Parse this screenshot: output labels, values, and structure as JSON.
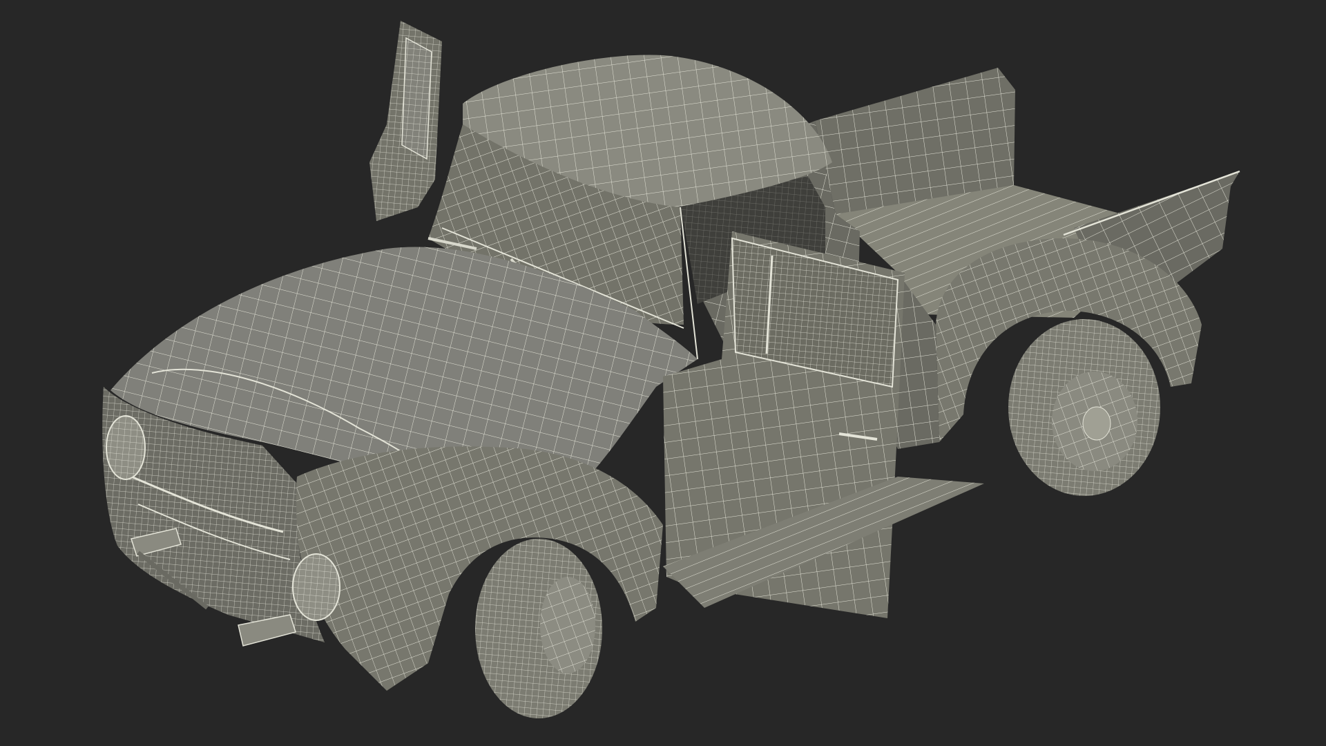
{
  "scene": {
    "subject": "pickup-truck-wireframe",
    "background_color": "#272727",
    "body_color": "#78786e",
    "body_shadow_color": "#5f5f57",
    "body_light_color": "#8a8a80",
    "wire_color": "#e4e4d8",
    "doors": {
      "driver_door": "open",
      "passenger_door": "open"
    }
  }
}
